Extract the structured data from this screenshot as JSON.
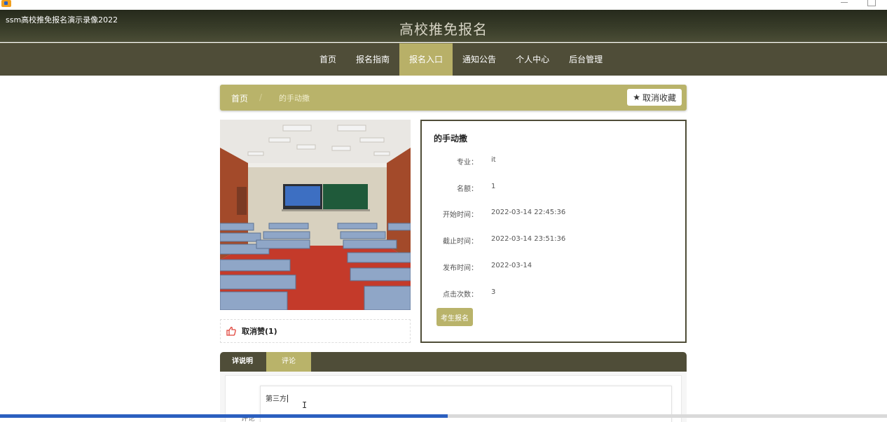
{
  "window": {
    "tab_title": "ssm高校推免报名演示录像2022"
  },
  "site": {
    "title": "高校推免报名"
  },
  "nav": {
    "items": [
      {
        "label": "首页"
      },
      {
        "label": "报名指南"
      },
      {
        "label": "报名入口",
        "active": true
      },
      {
        "label": "通知公告"
      },
      {
        "label": "个人中心"
      },
      {
        "label": "后台管理"
      }
    ]
  },
  "breadcrumb": {
    "home": "首页",
    "separator": "/",
    "current": "的手动撒",
    "favorite_label": "取消收藏"
  },
  "like": {
    "label": "取消赞(1)"
  },
  "detail": {
    "title": "的手动撒",
    "fields": [
      {
        "label": "专业：",
        "value": "it"
      },
      {
        "label": "名额：",
        "value": "1"
      },
      {
        "label": "开始时间：",
        "value": "2022-03-14 22:45:36"
      },
      {
        "label": "截止时间：",
        "value": "2022-03-14 23:51:36"
      },
      {
        "label": "发布时间：",
        "value": "2022-03-14"
      },
      {
        "label": "点击次数：",
        "value": "3"
      }
    ],
    "apply_label": "考生报名"
  },
  "tabs": {
    "items": [
      {
        "label": "详说明"
      },
      {
        "label": "评论",
        "active": true
      }
    ]
  },
  "comment": {
    "label": "评论",
    "value": "第三方"
  },
  "progress": {
    "percent": 50.5
  },
  "colors": {
    "header_dark": "#3a3e2a",
    "nav_bg": "#4f4d38",
    "accent": "#b9b36a",
    "like_icon": "#e0443b"
  }
}
